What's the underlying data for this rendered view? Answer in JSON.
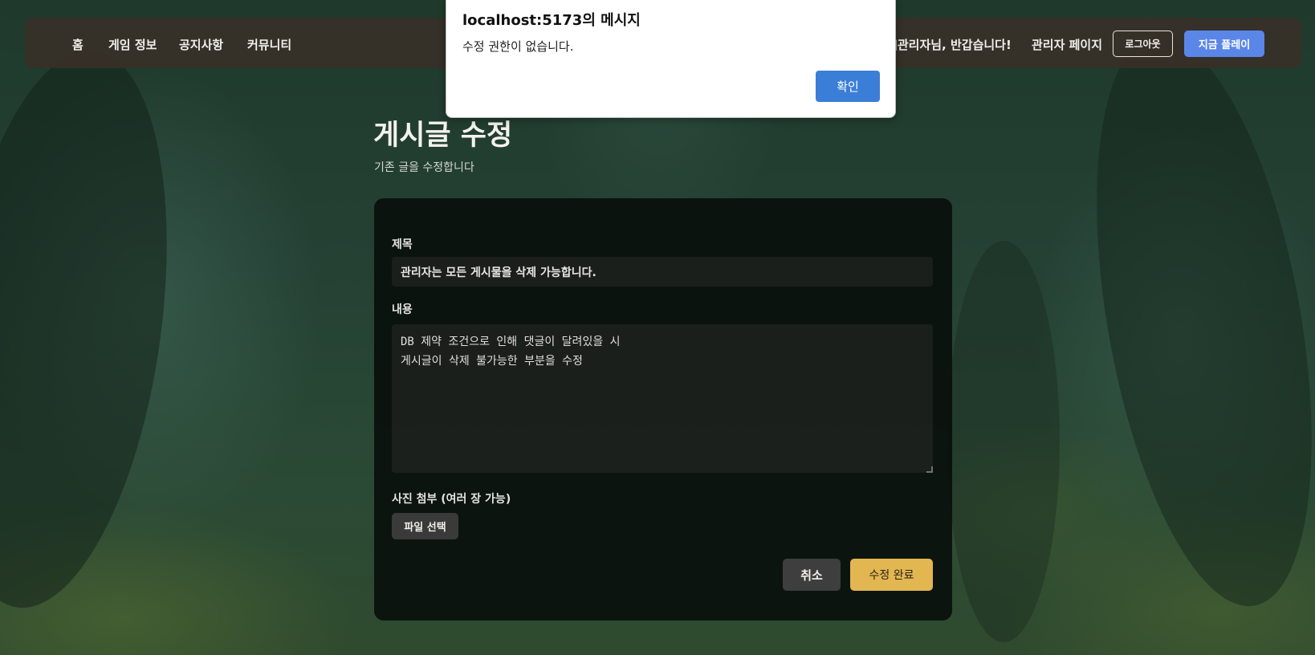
{
  "nav": {
    "links": [
      "홈",
      "게임 정보",
      "공지사항",
      "커뮤니티"
    ],
    "greeting": "]관리자님, 반갑습니다!",
    "admin_page": "관리자 페이지",
    "logout": "로그아웃",
    "play_now": "지금 플레이"
  },
  "page": {
    "title": "게시글 수정",
    "subtitle": "기존 글을 수정합니다"
  },
  "form": {
    "title_label": "제목",
    "title_value": "관리자는 모든 게시물을 삭제 가능합니다.",
    "content_label": "내용",
    "content_value": "DB 제약 조건으로 인해 댓글이 달려있을 시\n게시글이 삭제 불가능한 부분을 수정",
    "attach_label": "사진 첨부 (여러 장 가능)",
    "file_button": "파일 선택",
    "cancel": "취소",
    "submit": "수정 완료"
  },
  "dialog": {
    "title": "localhost:5173의 메시지",
    "message": "수정 권한이 없습니다.",
    "ok": "확인"
  },
  "colors": {
    "accent_blue": "#5a86e8",
    "submit_gold": "#e2b651",
    "dialog_blue": "#3b7ed7"
  }
}
